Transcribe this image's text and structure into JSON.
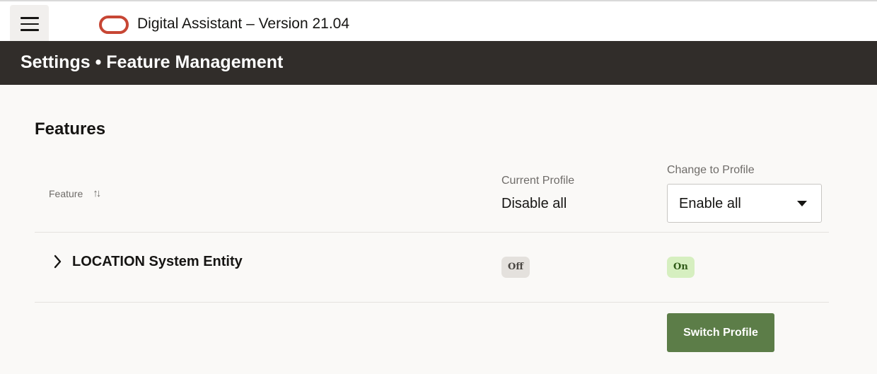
{
  "app": {
    "title": "Digital Assistant – Version 21.04"
  },
  "header": {
    "title": "Settings • Feature Management"
  },
  "features": {
    "title": "Features",
    "columns": {
      "feature": "Feature",
      "current_profile_label": "Current Profile",
      "current_profile_value": "Disable all",
      "change_to_profile_label": "Change to Profile"
    },
    "profile_select": {
      "selected": "Enable all"
    },
    "rows": [
      {
        "name": "LOCATION System Entity",
        "current_status": "Off",
        "target_status": "On"
      }
    ],
    "switch_button": "Switch Profile"
  },
  "colors": {
    "header_bg": "#312d2a",
    "logo_red": "#c74634",
    "primary_button": "#5c7d48",
    "badge_on_bg": "#d6efc0",
    "badge_off_bg": "#e4e1dd"
  },
  "icons": {
    "menu": "hamburger-icon",
    "logo": "oracle-logo",
    "sort": "sort-icon",
    "expand": "chevron-right-icon",
    "dropdown": "caret-down-icon"
  }
}
